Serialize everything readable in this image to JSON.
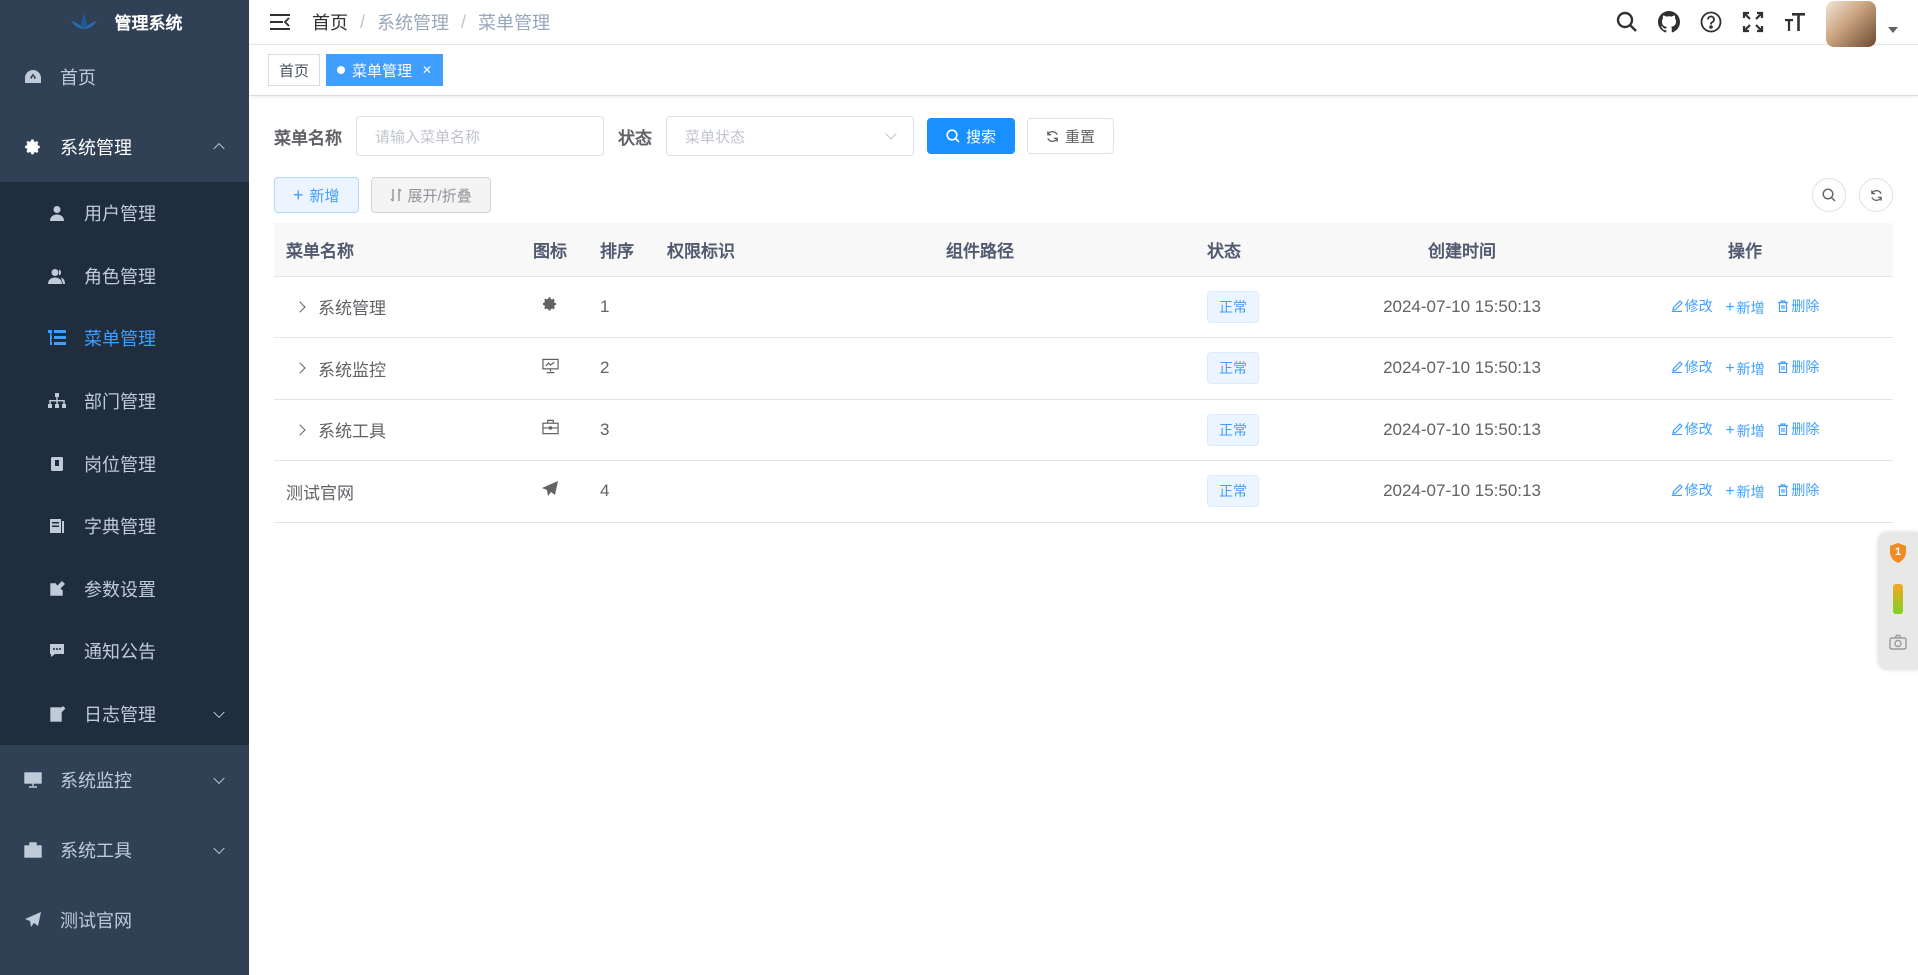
{
  "app": {
    "title": "管理系统"
  },
  "sidebar": {
    "items": [
      {
        "label": "首页"
      },
      {
        "label": "系统管理"
      },
      {
        "label": "系统监控"
      },
      {
        "label": "系统工具"
      },
      {
        "label": "测试官网"
      }
    ],
    "sub": [
      {
        "label": "用户管理"
      },
      {
        "label": "角色管理"
      },
      {
        "label": "菜单管理"
      },
      {
        "label": "部门管理"
      },
      {
        "label": "岗位管理"
      },
      {
        "label": "字典管理"
      },
      {
        "label": "参数设置"
      },
      {
        "label": "通知公告"
      },
      {
        "label": "日志管理"
      }
    ]
  },
  "breadcrumb": [
    "首页",
    "系统管理",
    "菜单管理"
  ],
  "tags": [
    "首页",
    "菜单管理"
  ],
  "filter": {
    "name_label": "菜单名称",
    "name_placeholder": "请输入菜单名称",
    "status_label": "状态",
    "status_placeholder": "菜单状态",
    "search": "搜索",
    "reset": "重置"
  },
  "toolbar": {
    "add": "新增",
    "expand": "展开/折叠"
  },
  "table": {
    "headers": [
      "菜单名称",
      "图标",
      "排序",
      "权限标识",
      "组件路径",
      "状态",
      "创建时间",
      "操作"
    ],
    "rows": [
      {
        "name": "系统管理",
        "icon": "gear-icon",
        "order": "1",
        "perm": "",
        "path": "",
        "status": "正常",
        "time": "2024-07-10 15:50:13"
      },
      {
        "name": "系统监控",
        "icon": "monitor-icon",
        "order": "2",
        "perm": "",
        "path": "",
        "status": "正常",
        "time": "2024-07-10 15:50:13"
      },
      {
        "name": "系统工具",
        "icon": "toolbox-icon",
        "order": "3",
        "perm": "",
        "path": "",
        "status": "正常",
        "time": "2024-07-10 15:50:13"
      },
      {
        "name": "测试官网",
        "icon": "paper-plane-icon",
        "order": "4",
        "perm": "",
        "path": "",
        "status": "正常",
        "time": "2024-07-10 15:50:13"
      }
    ],
    "ops": {
      "edit": "修改",
      "add": "新增",
      "delete": "删除"
    }
  },
  "float_badge": "1",
  "colors": {
    "sidebar": "#304156",
    "submenu": "#1f2d3d",
    "accent": "#409eff",
    "primary": "#1890ff"
  }
}
